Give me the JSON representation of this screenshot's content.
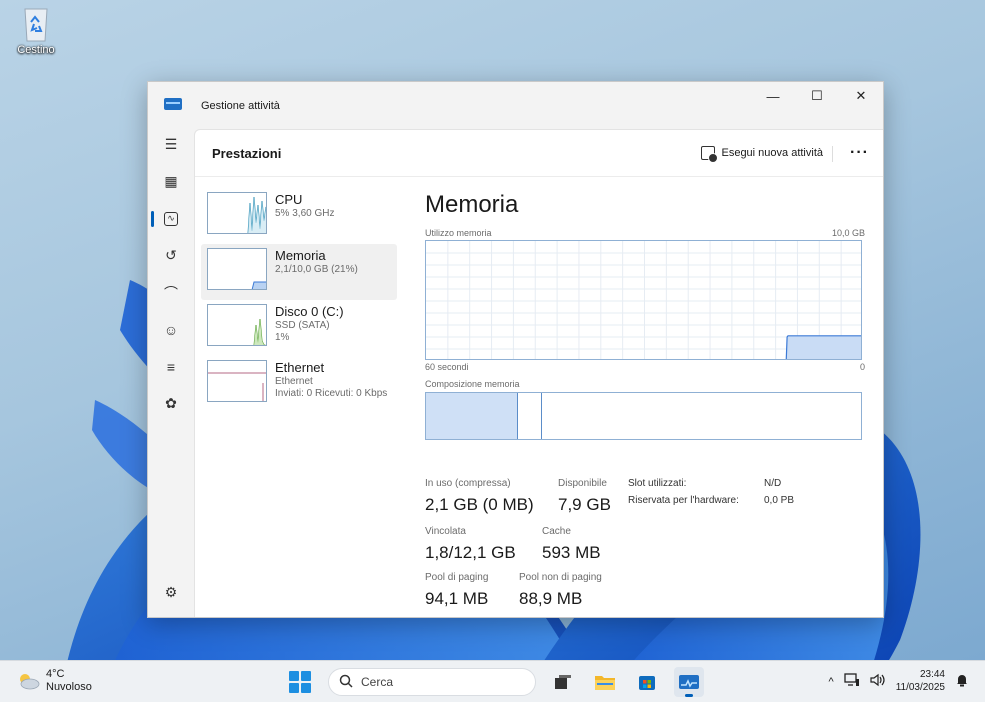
{
  "desktop": {
    "recycle_bin_label": "Cestino"
  },
  "window": {
    "title": "Gestione attività",
    "controls": {
      "minimize": "—",
      "maximize": "☐",
      "close": "✕"
    }
  },
  "nav": {
    "items": [
      {
        "name": "menu",
        "glyph": "☰"
      },
      {
        "name": "processes",
        "glyph": "▦"
      },
      {
        "name": "performance",
        "glyph": "∿",
        "active": true
      },
      {
        "name": "app-history",
        "glyph": "↺"
      },
      {
        "name": "startup-apps",
        "glyph": "⌒"
      },
      {
        "name": "users",
        "glyph": "☺"
      },
      {
        "name": "details",
        "glyph": "≡"
      },
      {
        "name": "services",
        "glyph": "✿"
      }
    ],
    "settings_glyph": "⚙"
  },
  "header": {
    "page_title": "Prestazioni",
    "run_task_label": "Esegui nuova attività",
    "more_label": "···"
  },
  "devices": [
    {
      "name": "CPU",
      "sub1": "5% 3,60 GHz",
      "sub2": ""
    },
    {
      "name": "Memoria",
      "sub1": "2,1/10,0 GB (21%)",
      "sub2": "",
      "selected": true
    },
    {
      "name": "Disco 0 (C:)",
      "sub1": "SSD (SATA)",
      "sub2": "1%"
    },
    {
      "name": "Ethernet",
      "sub1": "Ethernet",
      "sub2": "Inviati: 0 Ricevuti: 0 Kbps"
    }
  ],
  "memory": {
    "title": "Memoria",
    "usage_label": "Utilizzo memoria",
    "max_label": "10,0 GB",
    "time_label": "60 secondi",
    "zero_label": "0",
    "composition_label": "Composizione memoria",
    "usage_history_pct": [
      0,
      0,
      0,
      0,
      0,
      0,
      0,
      0,
      0,
      0,
      0,
      0,
      0,
      0,
      0,
      0,
      0,
      0,
      0,
      0,
      0,
      0,
      0,
      0,
      0,
      0,
      0,
      0,
      0,
      0,
      0,
      0,
      0,
      0,
      0,
      0,
      0,
      0,
      0,
      0,
      0,
      0,
      0,
      0,
      0,
      0,
      0,
      0,
      0,
      0,
      0,
      0,
      0,
      0,
      0,
      0,
      0,
      0,
      0,
      0,
      0,
      0,
      0,
      0,
      0,
      0,
      0,
      0,
      0,
      0,
      0,
      0,
      0,
      0,
      0,
      0,
      0,
      0,
      0,
      0,
      0,
      0,
      0,
      0,
      0,
      0,
      0,
      0,
      0,
      0,
      0,
      0,
      0,
      0,
      0,
      0,
      0,
      0,
      0,
      0,
      0,
      0,
      0,
      0,
      0,
      0,
      0,
      0,
      0,
      0,
      0,
      0,
      0,
      0,
      0,
      0,
      0,
      0,
      0,
      0,
      0,
      0,
      0,
      0,
      0,
      0,
      0,
      0,
      0,
      0,
      0,
      0,
      0,
      0,
      0,
      0,
      0,
      0,
      0,
      0,
      0,
      0,
      0,
      0,
      0,
      0,
      0,
      0,
      0,
      0,
      0,
      0,
      0,
      0,
      0,
      0,
      0,
      0,
      0,
      0,
      0,
      0,
      0,
      0,
      0,
      0,
      0,
      0,
      0,
      0,
      0,
      0,
      0,
      0,
      0,
      0,
      0,
      0,
      0,
      0,
      0,
      0,
      0,
      0,
      0,
      0,
      0,
      0,
      0,
      0,
      0,
      0,
      0,
      0,
      0,
      0,
      0,
      0,
      0,
      0,
      0,
      0,
      0,
      0,
      0,
      0,
      0,
      0,
      0,
      0,
      0,
      0,
      0,
      0,
      0,
      0,
      0,
      0,
      0,
      0,
      0,
      0,
      0,
      0,
      0,
      0,
      0,
      0,
      0,
      0,
      0,
      0,
      0,
      0,
      0,
      0,
      0,
      0,
      0,
      0,
      0,
      0,
      0,
      0,
      0,
      0,
      0,
      0,
      0,
      0,
      0,
      0,
      0,
      0,
      0,
      0,
      0,
      0,
      0,
      0,
      0,
      0,
      0,
      0,
      0,
      0,
      0,
      0,
      0,
      0,
      0,
      0,
      0,
      0,
      0,
      0,
      0,
      0,
      0,
      0,
      0,
      0,
      0,
      0,
      0,
      0,
      0,
      0,
      0,
      0,
      0,
      0,
      0,
      0,
      0,
      0,
      0,
      0,
      0,
      0,
      0,
      0,
      0,
      0,
      0,
      0,
      0,
      0,
      0,
      0,
      0,
      0,
      0,
      0,
      0,
      0,
      0,
      0,
      0,
      0,
      0,
      0,
      0,
      0,
      0,
      0,
      0,
      0,
      0,
      0,
      0,
      0,
      0,
      0,
      0,
      0,
      0,
      0,
      0,
      0,
      0,
      0,
      0,
      0,
      0,
      0,
      0,
      0,
      0,
      0,
      0,
      0,
      0,
      0,
      0,
      0,
      0,
      0,
      0,
      0,
      0,
      0,
      0,
      0,
      0,
      0,
      0,
      0,
      0,
      0,
      0,
      0,
      0,
      0,
      0,
      0,
      0,
      0,
      0,
      0,
      0,
      0,
      0,
      0,
      0,
      0,
      0,
      0,
      0,
      0,
      0,
      0,
      0,
      0,
      0,
      20,
      21,
      21,
      21,
      21,
      21,
      21,
      21,
      21,
      21,
      21,
      21,
      21,
      21,
      21,
      21,
      21,
      21,
      21,
      21,
      21,
      21,
      21,
      21,
      21,
      21,
      21,
      21,
      21,
      21,
      21,
      21,
      21,
      21,
      21,
      21,
      21,
      21,
      21,
      21,
      21,
      21,
      21,
      21,
      21,
      21,
      21,
      21,
      21,
      21,
      21,
      21,
      21,
      21,
      21,
      21,
      21,
      21,
      21,
      21,
      21,
      21,
      21,
      21,
      21,
      21,
      21,
      21,
      21,
      21,
      21,
      21,
      21,
      21,
      21,
      21,
      21,
      21,
      21,
      21,
      21,
      21,
      21,
      21
    ],
    "stats": {
      "in_use_label": "In uso (compressa)",
      "in_use_value": "2,1 GB (0 MB)",
      "available_label": "Disponibile",
      "available_value": "7,9 GB",
      "committed_label": "Vincolata",
      "committed_value": "1,8/12,1 GB",
      "cached_label": "Cache",
      "cached_value": "593 MB",
      "paged_label": "Pool di paging",
      "paged_value": "94,1 MB",
      "nonpaged_label": "Pool non di paging",
      "nonpaged_value": "88,9 MB",
      "slots_label": "Slot utilizzati:",
      "slots_value": "N/D",
      "reserved_label": "Riservata per l'hardware:",
      "reserved_value": "0,0 PB"
    }
  },
  "taskbar": {
    "weather_temp": "4°C",
    "weather_desc": "Nuvoloso",
    "search_placeholder": "Cerca",
    "time": "23:44",
    "date": "11/03/2025"
  }
}
